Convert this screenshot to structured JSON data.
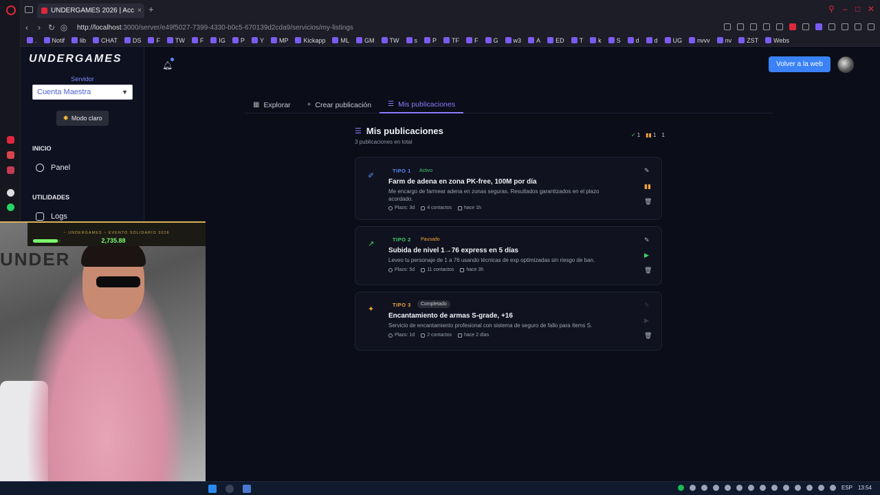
{
  "browser": {
    "tab_title": "UNDERGAMES 2026 | Acc",
    "url_host": "http://localhost",
    "url_path": ":3000/server/e49f5027-7399-4330-b0c5-670139d2cda9/servicios/my-listings",
    "bookmarks": [
      ".",
      "Notif",
      "lib",
      "CHAT",
      "DS",
      "F",
      "TW",
      "F",
      "IG",
      "P",
      "Y",
      "MP",
      "Kickapp",
      "ML",
      "GM",
      "TW",
      "s",
      "P",
      "TF",
      "F",
      "G",
      "w3",
      "A",
      "ED",
      "T",
      "k",
      "S",
      "d",
      "d",
      "UG",
      "nvvv",
      "nv",
      "ZST",
      "Webs"
    ]
  },
  "sidebar": {
    "logo": "UNDERGAMES",
    "server_label": "Servidor",
    "server_value": "Cuenta Maestra",
    "mode_button": "Modo claro",
    "section_inicio": "INICIO",
    "panel": "Panel",
    "section_utilidades": "UTILIDADES",
    "logs": "Logs"
  },
  "header": {
    "back_button": "Volver a la web"
  },
  "tabs": [
    {
      "label": "Explorar",
      "icon": "grid-icon"
    },
    {
      "label": "Crear publicación",
      "icon": "plus-icon"
    },
    {
      "label": "Mis publicaciones",
      "icon": "list-icon"
    }
  ],
  "main": {
    "title": "Mis publicaciones",
    "subtitle": "3 publicaciones en total",
    "counts": {
      "active": "1",
      "paused": "1",
      "completed": "1"
    }
  },
  "listings": [
    {
      "type": "TIPO 1",
      "status": "Activo",
      "title": "Farm de adena en zona PK-free, 100M por día",
      "description": "Me encargo de farmear adena en zonas seguras. Resultados garantizados en el plazo acordado.",
      "plazo": "Plazo: 3d",
      "contactos": "4 contactos",
      "hace": "hace 1h",
      "icon": "rocket-icon",
      "color": "#5b8cff"
    },
    {
      "type": "TIPO 2",
      "status": "Pausado",
      "title": "Subida de nivel 1→76 express en 5 días",
      "description": "Leveo tu personaje de 1 a 76 usando técnicas de exp optimizadas sin riesgo de ban.",
      "plazo": "Plazo: 5d",
      "contactos": "11 contactos",
      "hace": "hace 3h",
      "icon": "trending-up-icon",
      "color": "#3ecf6e"
    },
    {
      "type": "TIPO 3",
      "status": "Completado",
      "title": "Encantamiento de armas S-grade, +16",
      "description": "Servicio de encantamiento profesional con sistema de seguro de fallo para ítems S.",
      "plazo": "Plazo: 1d",
      "contactos": "2 contactos",
      "hace": "hace 2 días",
      "icon": "sparkles-icon",
      "color": "#f0a43a"
    }
  ],
  "stream_overlay": {
    "event": "~ UNDERGAMES ~ EVENTO SOLIDARIO 2026",
    "amount": "2,735.88",
    "bg_text": "UNDER"
  },
  "taskbar": {
    "lang": "ESP",
    "time": "13:54"
  }
}
